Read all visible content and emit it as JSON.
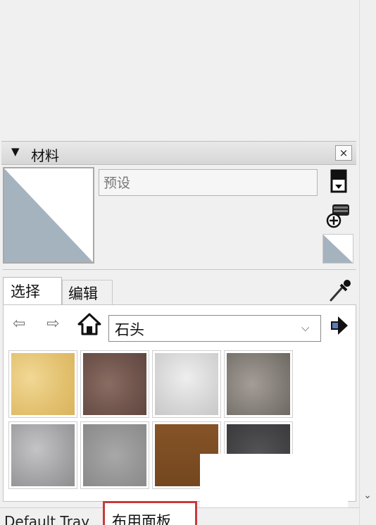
{
  "materials_panel": {
    "title": "材料",
    "collapse_glyph": "▼",
    "close_glyph": "×",
    "name_placeholder": "预设",
    "tabs": [
      {
        "label": "选择"
      },
      {
        "label": "编辑"
      }
    ],
    "nav": {
      "back_glyph": "⇦",
      "forward_glyph": "⇨",
      "collection": "石头",
      "chevron_glyph": "⌵"
    },
    "swatches": [
      {
        "name": "sandstone-yellow",
        "color": "#e6c878"
      },
      {
        "name": "granite-brown",
        "color": "#7b5e55"
      },
      {
        "name": "marble-white",
        "color": "#dcdcdc"
      },
      {
        "name": "granite-gray",
        "color": "#8a8580"
      },
      {
        "name": "marble-gray",
        "color": "#a4a4a6"
      },
      {
        "name": "concrete-gray",
        "color": "#9b9b9b"
      },
      {
        "name": "wood-brown",
        "color": "#7a4b22"
      },
      {
        "name": "stone-dark",
        "color": "#4a4a4c"
      }
    ]
  },
  "scrollbar": {
    "down_glyph": "⌄"
  },
  "tray_tabs": [
    {
      "label": "Default Tray"
    },
    {
      "label": "布用面板"
    }
  ],
  "colors": {
    "accent_highlight": "#c93a3a",
    "preview_fill": "#a5b3bf"
  }
}
